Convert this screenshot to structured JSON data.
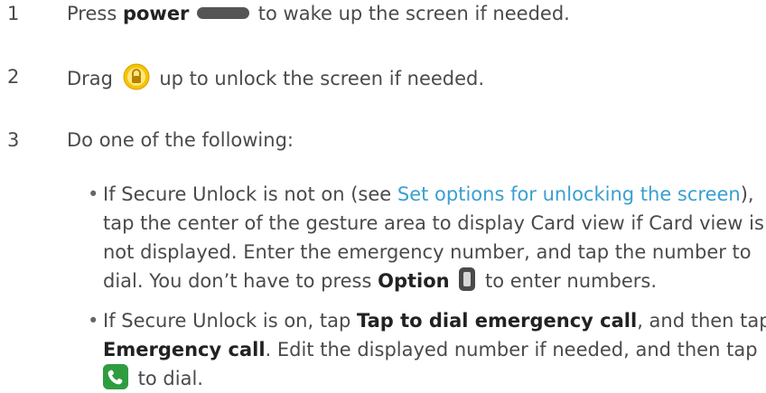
{
  "steps": [
    {
      "number": "1",
      "pre": "Press ",
      "bold": "power",
      "post": " to wake up the screen if needed."
    },
    {
      "number": "2",
      "pre": "Drag ",
      "post": " up to unlock the screen if needed."
    },
    {
      "number": "3",
      "text": "Do one of the following:"
    }
  ],
  "bullet1": {
    "line1_pre": "If Secure Unlock is not on (see ",
    "line1_link": "Set options for unlocking the screen",
    "line1_post": "),",
    "line2": "tap the center of the gesture area to display Card view if Card view is",
    "line3": "not displayed. Enter the emergency number, and tap the number to",
    "line4_pre": "dial. You don’t have to press ",
    "line4_bold": "Option",
    "line4_post": " to enter numbers."
  },
  "bullet2": {
    "line1_pre": "If Secure Unlock is on, tap ",
    "line1_bold": "Tap to dial emergency call",
    "line1_post": ", and then tap",
    "line2_bold": "Emergency call",
    "line2_post": ". Edit the displayed number if needed, and then tap",
    "line3_post": " to dial."
  },
  "bullet_symbol": "•",
  "icons": {
    "power": "power-button-icon",
    "lock": "lock-icon",
    "option": "option-key-icon",
    "phone": "phone-icon"
  },
  "colors": {
    "link": "#3a9fd0",
    "text": "#4a4a4a"
  }
}
